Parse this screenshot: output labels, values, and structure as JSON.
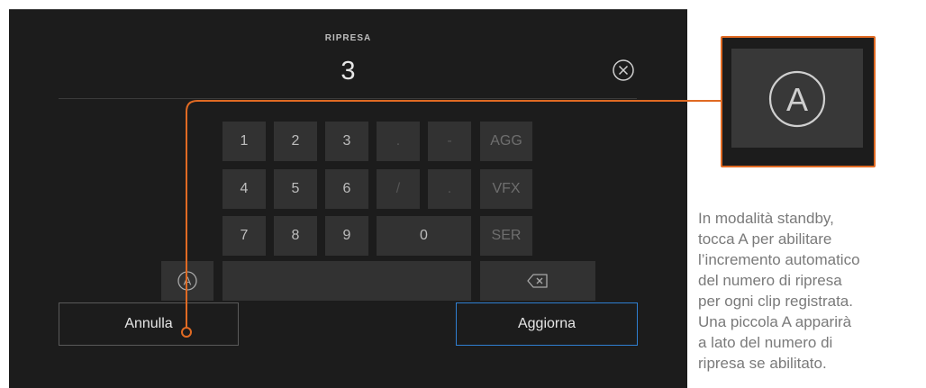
{
  "field": {
    "label": "RIPRESA",
    "value": "3"
  },
  "keypad": {
    "row1": [
      "1",
      "2",
      "3",
      ".",
      "-",
      "AGG"
    ],
    "row2": [
      "4",
      "5",
      "6",
      "/",
      ".",
      "VFX"
    ],
    "row3": [
      "7",
      "8",
      "9",
      "0",
      "SER"
    ],
    "auto_icon": "A"
  },
  "buttons": {
    "cancel": "Annulla",
    "update": "Aggiorna"
  },
  "callout": {
    "icon_letter": "A",
    "lines": [
      "In modalità standby,",
      "tocca A per abilitare",
      "l’incremento automatico",
      "del numero di ripresa",
      "per ogni clip registrata.",
      "Una piccola A apparirà",
      "a lato del numero di",
      "ripresa se abilitato."
    ]
  },
  "colors": {
    "accent_orange": "#e06a23",
    "primary_blue": "#2f7fd1",
    "panel": "#1c1c1c",
    "key": "#323232"
  }
}
